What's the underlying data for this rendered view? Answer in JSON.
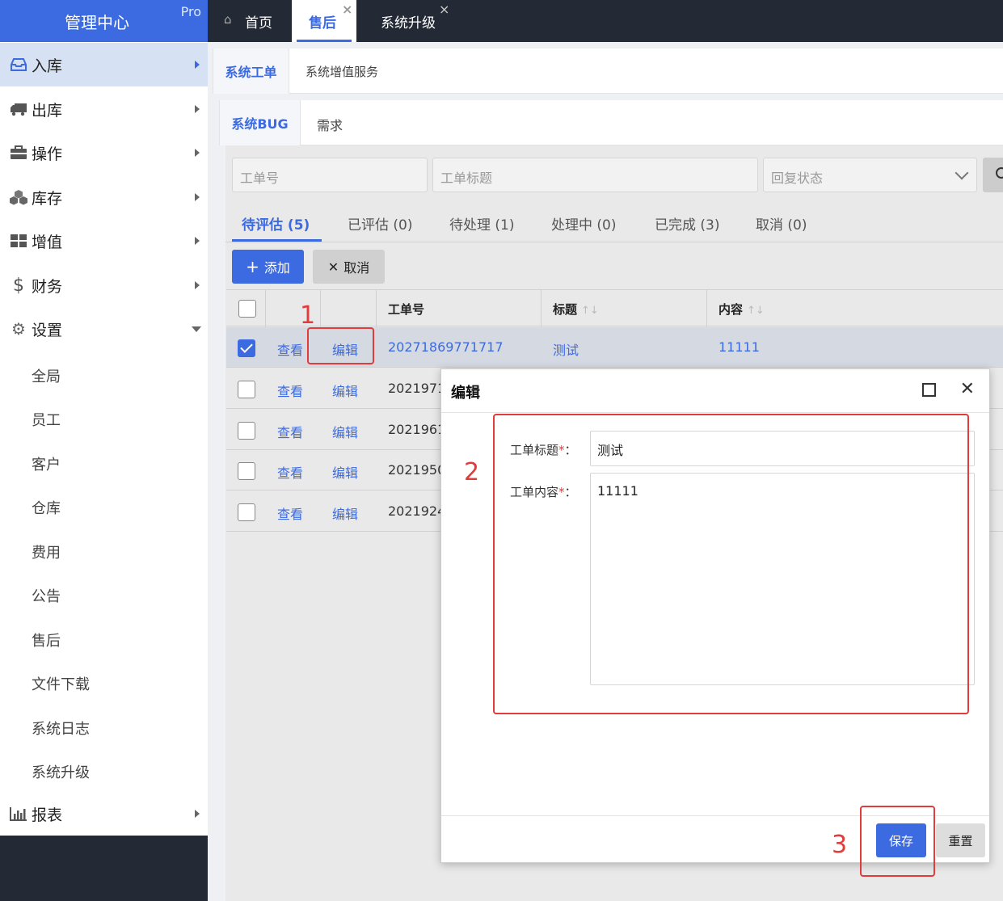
{
  "brand": {
    "title": "管理中心",
    "badge": "Pro"
  },
  "sidebar": {
    "items": [
      {
        "label": "入库",
        "icon": "inbox-icon"
      },
      {
        "label": "出库",
        "icon": "truck-icon"
      },
      {
        "label": "操作",
        "icon": "briefcase-icon"
      },
      {
        "label": "库存",
        "icon": "cubes-icon"
      },
      {
        "label": "增值",
        "icon": "grid-icon"
      },
      {
        "label": "财务",
        "icon": "dollar-icon"
      },
      {
        "label": "设置",
        "icon": "gears-icon"
      },
      {
        "label": "报表",
        "icon": "bar-chart-icon"
      }
    ],
    "sub_items": [
      "全局",
      "员工",
      "客户",
      "仓库",
      "费用",
      "公告",
      "售后",
      "文件下载",
      "系统日志",
      "系统升级"
    ]
  },
  "top_tabs": [
    {
      "label": "首页",
      "icon": "home-icon"
    },
    {
      "label": "售后",
      "close": "×"
    },
    {
      "label": "系统升级",
      "close": "×"
    }
  ],
  "tabs_level1": [
    "系统工单",
    "系统增值服务"
  ],
  "tabs_level2": [
    "系统BUG",
    "需求"
  ],
  "filters": {
    "ticket_no_placeholder": "工单号",
    "title_placeholder": "工单标题",
    "reply_status_placeholder": "回复状态"
  },
  "status_tabs": [
    "待评估 (5)",
    "已评估 (0)",
    "待处理 (1)",
    "处理中 (0)",
    "已完成 (3)",
    "取消 (0)"
  ],
  "actions": {
    "add_label": "添加",
    "cancel_label": "取消"
  },
  "table": {
    "headers": [
      "工单号",
      "标题",
      "内容"
    ],
    "rows": [
      {
        "view": "查看",
        "edit": "编辑",
        "ticket_no": "20271869771717",
        "title": "测试",
        "content": "11111",
        "checked": true
      },
      {
        "view": "查看",
        "edit": "编辑",
        "ticket_no": "2021971",
        "title": "",
        "content": "",
        "checked": false
      },
      {
        "view": "查看",
        "edit": "编辑",
        "ticket_no": "2021961",
        "title": "",
        "content": "",
        "checked": false
      },
      {
        "view": "查看",
        "edit": "编辑",
        "ticket_no": "2021950",
        "title": "",
        "content": "",
        "checked": false
      },
      {
        "view": "查看",
        "edit": "编辑",
        "ticket_no": "2021924",
        "title": "",
        "content": "",
        "checked": false
      }
    ]
  },
  "modal": {
    "title": "编辑",
    "fields": {
      "title_label": "工单标题",
      "title_value": "测试",
      "content_label": "工单内容",
      "content_value": "11111",
      "required_mark": "*",
      "colon": "："
    },
    "save_label": "保存",
    "reset_label": "重置"
  },
  "annotations": [
    "1",
    "2",
    "3"
  ],
  "colors": {
    "accent": "#3c6ae0",
    "topbar": "#232a35",
    "annotation": "#e03c3c"
  }
}
